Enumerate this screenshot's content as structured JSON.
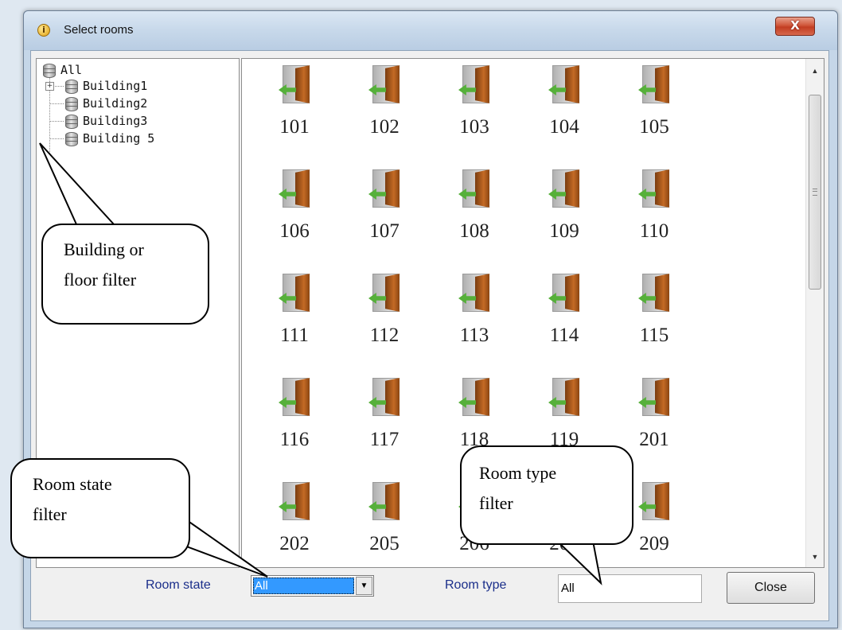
{
  "window": {
    "title": "Select rooms",
    "title_icon": "info-icon",
    "close_glyph": "X"
  },
  "tree": {
    "root_label": "All",
    "buildings": [
      "Building1",
      "Building2",
      "Building3",
      "Building 5"
    ],
    "expandable": [
      "Building1"
    ]
  },
  "rooms": [
    "101",
    "102",
    "103",
    "104",
    "105",
    "106",
    "107",
    "108",
    "109",
    "110",
    "111",
    "112",
    "113",
    "114",
    "115",
    "116",
    "117",
    "118",
    "119",
    "201",
    "202",
    "205",
    "206",
    "207",
    "209"
  ],
  "footer": {
    "room_state_label": "Room state",
    "room_state_value": "All",
    "room_type_label": "Room type",
    "room_type_value": "All",
    "close_label": "Close"
  },
  "annotations": {
    "building_filter_line1": "Building or",
    "building_filter_line2": "floor filter",
    "room_type_filter_line1": "Room type",
    "room_type_filter_line2": "filter",
    "room_state_filter_line1": "Room state",
    "room_state_filter_line2": "filter"
  },
  "colors": {
    "label_blue": "#1a2e8a",
    "selection_blue": "#3399ff",
    "close_red": "#c23d22"
  }
}
